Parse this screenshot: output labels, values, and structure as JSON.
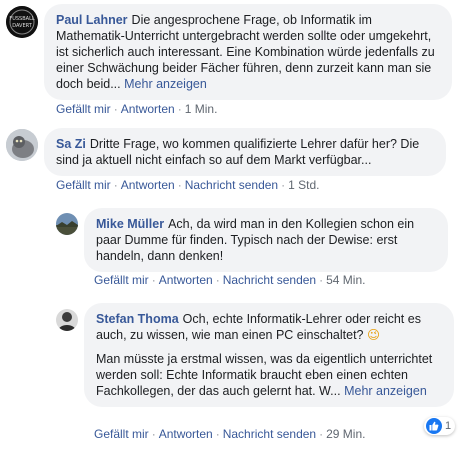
{
  "comments": [
    {
      "author": "Paul Lahner",
      "text": "Die angesprochene Frage, ob Informatik im Mathematik-Unterricht untergebracht werden sollte oder umgekehrt, ist sicherlich auch interessant. Eine Kombination würde jedenfalls zu einer Schwächung beider Fächer führen, denn zurzeit kann man sie doch beid...",
      "more": "Mehr anzeigen",
      "like": "Gefällt mir",
      "reply": "Antworten",
      "time": "1 Min.",
      "avatar_text": [
        "FUSSBALL",
        "DAVERT"
      ]
    },
    {
      "author": "Sa Zi",
      "text": "Dritte Frage, wo kommen qualifizierte Lehrer dafür her? Die sind ja aktuell nicht einfach so auf dem Markt verfügbar...",
      "like": "Gefällt mir",
      "reply": "Antworten",
      "message": "Nachricht senden",
      "time": "1 Std."
    },
    {
      "author": "Mike Müller",
      "text": "Ach, da wird man in den Kollegien schon ein paar Dumme für finden. Typisch nach der Dewise: erst handeln, dann denken!",
      "like": "Gefällt mir",
      "reply": "Antworten",
      "message": "Nachricht senden",
      "time": "54 Min."
    },
    {
      "author": "Stefan Thoma",
      "text": "Och, echte Informatik-Lehrer oder reicht es auch, zu wissen, wie man einen PC einschaltet?",
      "emoji": "😉",
      "text2": "Man müsste ja erstmal wissen, was da eigentlich unterrichtet werden soll: Echte Informatik braucht eben einen echten Fachkollegen, der das auch gelernt hat. W...",
      "more": "Mehr anzeigen",
      "like": "Gefällt mir",
      "reply": "Antworten",
      "message": "Nachricht senden",
      "time": "29 Min.",
      "reaction_count": "1"
    }
  ],
  "separator": "·",
  "colors": {
    "link": "#385898",
    "bubble": "#f2f3f5",
    "like_blue": "#1877f2",
    "meta": "#606770"
  }
}
